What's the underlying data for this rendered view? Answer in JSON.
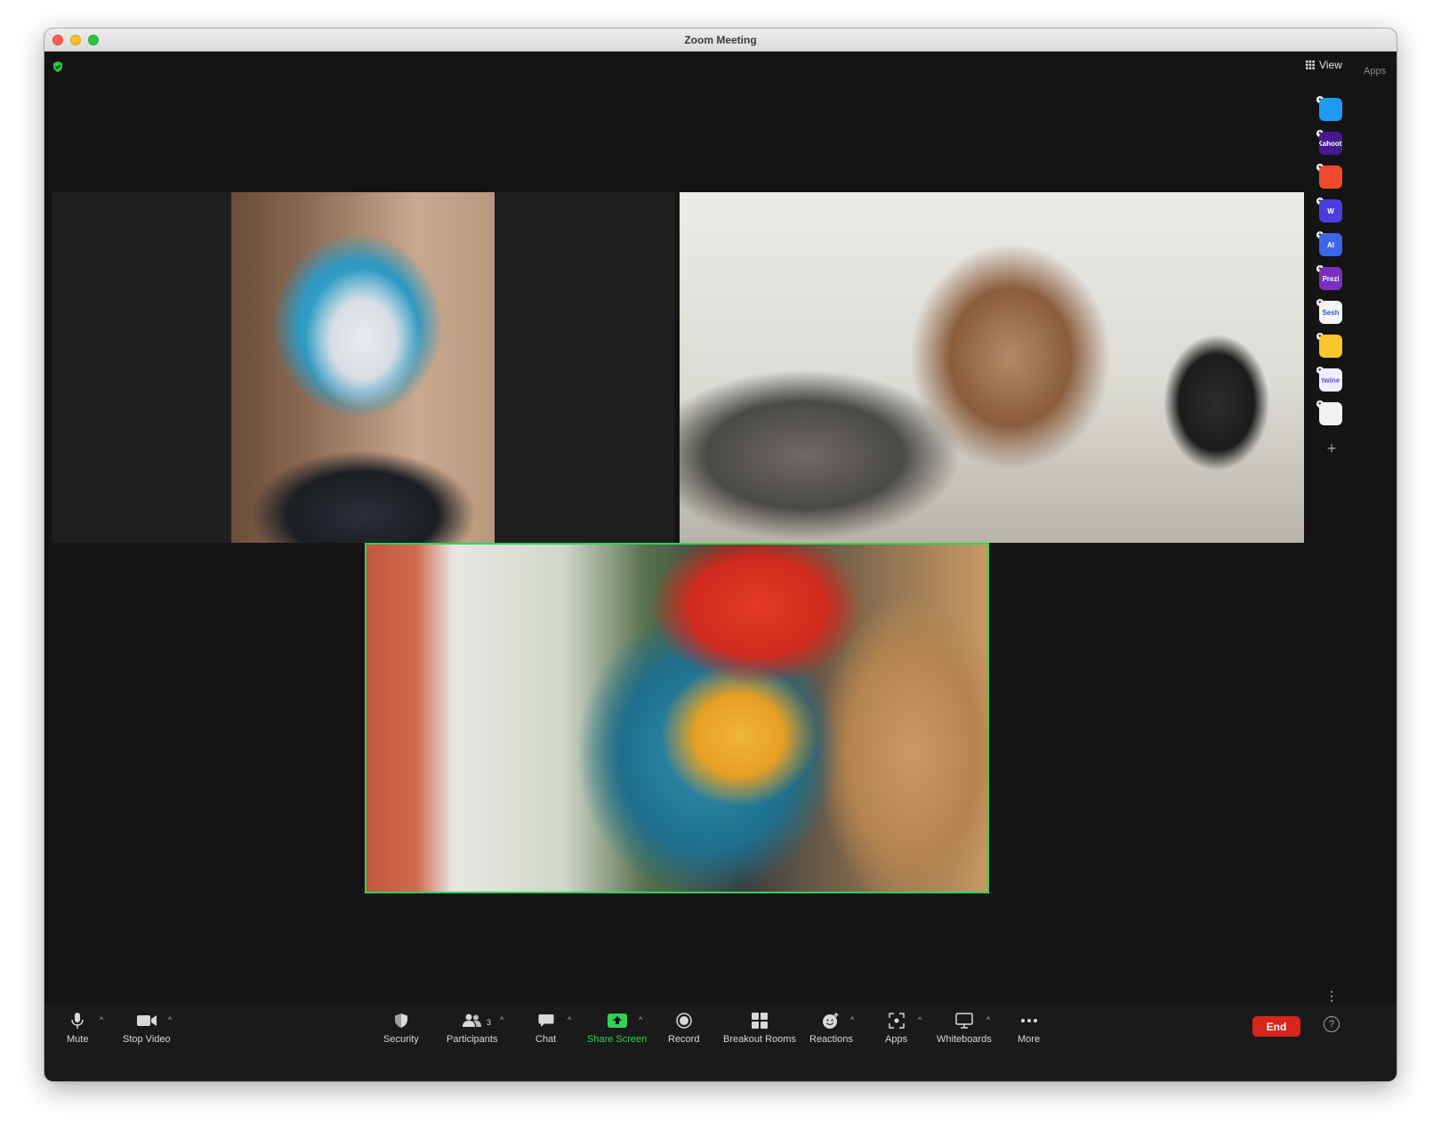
{
  "window": {
    "title": "Zoom Meeting"
  },
  "header": {
    "view_label": "View",
    "apps_label": "Apps"
  },
  "colors": {
    "active_speaker_border": "#2ed35a",
    "end_button": "#d9251c",
    "share_screen": "#34d058"
  },
  "apps_rail": {
    "items": [
      {
        "icon": "app-arrow-icon",
        "label": "",
        "bg": "#1e9bf0"
      },
      {
        "icon": "app-kahoot-icon",
        "label": "Kahoot!",
        "bg": "#46178f"
      },
      {
        "icon": "app-red-block-icon",
        "label": "",
        "bg": "#f04a2a"
      },
      {
        "icon": "app-w-icon",
        "label": "W",
        "bg": "#4c3de0"
      },
      {
        "icon": "app-ai-icon",
        "label": "AI",
        "bg": "#3c66e8"
      },
      {
        "icon": "app-prezi-icon",
        "label": "Prezi",
        "bg": "#7a2fbf"
      },
      {
        "icon": "app-sesh-icon",
        "label": "Sesh",
        "bg": "#f4f4f8"
      },
      {
        "icon": "app-smiley-icon",
        "label": "",
        "bg": "#f8c72b"
      },
      {
        "icon": "app-twine-icon",
        "label": "twine",
        "bg": "#f0eefa"
      },
      {
        "icon": "app-grid-icon",
        "label": "",
        "bg": "#f2f2f2"
      }
    ]
  },
  "toolbar": {
    "mute": "Mute",
    "stop_video": "Stop Video",
    "security": "Security",
    "participants": "Participants",
    "participants_count": "3",
    "chat": "Chat",
    "share_screen": "Share Screen",
    "record": "Record",
    "breakout_rooms": "Breakout Rooms",
    "reactions": "Reactions",
    "apps": "Apps",
    "whiteboards": "Whiteboards",
    "more": "More",
    "end": "End",
    "help": "?"
  }
}
